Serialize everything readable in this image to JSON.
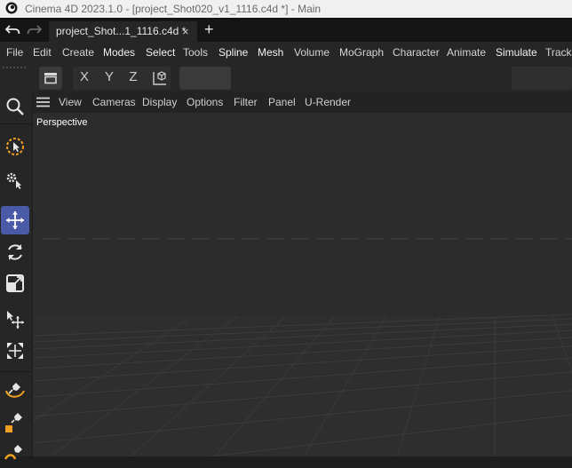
{
  "window": {
    "title": "Cinema 4D 2023.1.0 - [project_Shot020_v1_1116.c4d *] - Main"
  },
  "tabbar": {
    "undo_icon": "undo-icon",
    "redo_icon": "redo-icon",
    "tab_label": "project_Shot...1_1116.c4d *",
    "close_glyph": "×",
    "new_tab_glyph": "+"
  },
  "menu": {
    "items": [
      "File",
      "Edit",
      "Create",
      "Modes",
      "Select",
      "Tools",
      "Spline",
      "Mesh",
      "Volume",
      "MoGraph",
      "Character",
      "Animate",
      "Simulate",
      "Tracker"
    ]
  },
  "toolbar": {
    "axis_x": "X",
    "axis_y": "Y",
    "axis_z": "Z",
    "colors": {
      "x": "#e05a3a",
      "y": "#6fbf4a",
      "z": "#3f7fd8",
      "accent": "#f0a020"
    }
  },
  "viewport": {
    "menu": [
      "View",
      "Cameras",
      "Display",
      "Options",
      "Filter",
      "Panel",
      "U-Render"
    ],
    "label": "Perspective"
  },
  "colors": {
    "active_tool": "#4a5aa6",
    "orange": "#f0a020"
  }
}
